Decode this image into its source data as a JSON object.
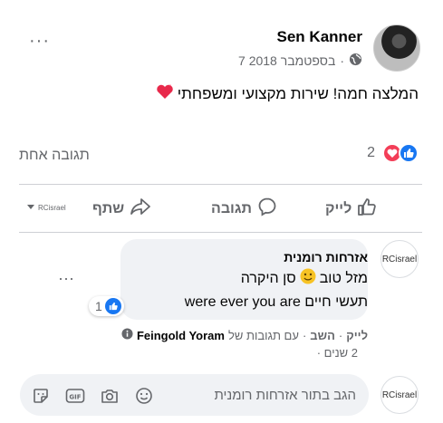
{
  "post": {
    "author": "Sen Kanner",
    "date": "7 בספטמבר 2018",
    "separator": "·",
    "text": "המלצה חמה! שירות מקצועי ומשפחתי",
    "more_glyph": "···"
  },
  "reactions": {
    "count": "2",
    "comments_count": "תגובה אחת"
  },
  "actions": {
    "like": "לייק",
    "comment": "תגובה",
    "share": "שתף",
    "share_page": "RCisrael"
  },
  "comment": {
    "avatar_text": "RCisrael",
    "author": "אזרחות רומנית",
    "line1": "מזל טוב",
    "line1_suffix": "סן היקרה",
    "line2": "תעשי חיים were ever you are",
    "reaction_count": "1",
    "like": "לייק",
    "reply": "השב",
    "replied_by_prefix": "עם תגובות של",
    "replied_by_name": "Feingold Yoram",
    "time": "2 שנים",
    "more_glyph": "···"
  },
  "reply_box": {
    "avatar_text": "RCisrael",
    "placeholder": "הגב בתור אזרחות רומנית"
  },
  "colors": {
    "like_blue": "#1877f2",
    "love_red": "#f33e58",
    "muted": "#65676b"
  },
  "icons": [
    "globe-icon",
    "heart-emoji-icon",
    "love-reaction-icon",
    "like-reaction-icon",
    "like-icon",
    "comment-icon",
    "share-icon",
    "smile-emoji-icon",
    "sticker-icon",
    "gif-icon",
    "camera-icon",
    "emoji-icon",
    "info-icon"
  ]
}
